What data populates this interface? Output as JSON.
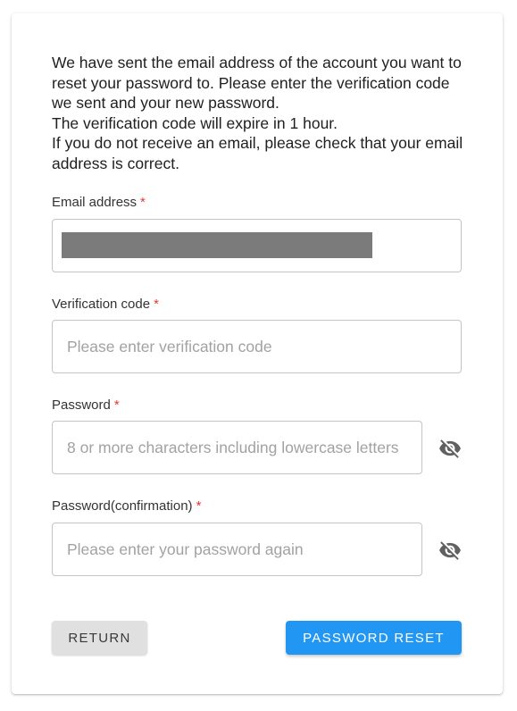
{
  "intro": {
    "text": "We have sent the email address of the account you want to reset your password to. Please enter the verification code we sent and your new password.\nThe verification code will expire in 1 hour.\nIf you do not receive an email, please check that your email address is correct."
  },
  "form": {
    "required_mark": "*",
    "email": {
      "label": "Email address",
      "value": ""
    },
    "verification_code": {
      "label": "Verification code",
      "placeholder": "Please enter verification code",
      "value": ""
    },
    "password": {
      "label": "Password",
      "placeholder": "8 or more characters including lowercase letters",
      "value": "",
      "toggle_icon": "eye-off-icon"
    },
    "password_confirmation": {
      "label": "Password(confirmation)",
      "placeholder": "Please enter your password again",
      "value": "",
      "toggle_icon": "eye-off-icon"
    }
  },
  "actions": {
    "return_label": "Return",
    "reset_label": "Password reset"
  },
  "colors": {
    "primary": "#2196f3",
    "required": "#e53935",
    "secondary_button": "#e0e0e0"
  }
}
